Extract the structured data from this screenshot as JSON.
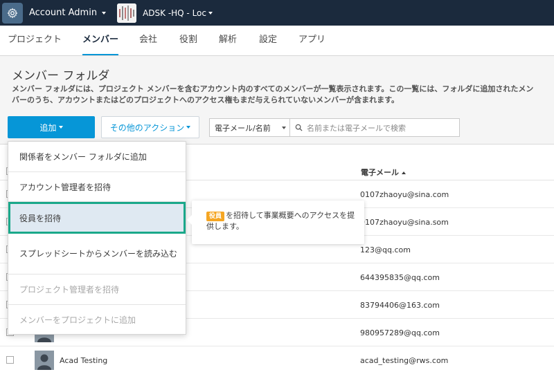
{
  "header": {
    "account_label": "Account Admin",
    "hub_label": "ADSK -HQ - Loc"
  },
  "nav": {
    "tabs": [
      {
        "label": "プロジェクト"
      },
      {
        "label": "メンバー"
      },
      {
        "label": "会社"
      },
      {
        "label": "役割"
      },
      {
        "label": "解析"
      },
      {
        "label": "設定"
      },
      {
        "label": "アプリ"
      }
    ],
    "active_tab": "メンバー"
  },
  "main": {
    "title": "メンバー フォルダ",
    "description": "メンバー フォルダには、プロジェクト メンバーを含むアカウント内のすべてのメンバーが一覧表示されます。この一覧には、フォルダに追加されたメンバーのうち、アカウントまたはどのプロジェクトへのアクセス権もまだ与えられていないメンバーが含まれます。"
  },
  "toolbar": {
    "add_label": "追加",
    "more_actions_label": "その他のアクション",
    "filter_value": "電子メール/名前",
    "search_placeholder": "名前または電子メールで検索"
  },
  "table": {
    "email_header": "電子メール",
    "rows": [
      {
        "name": "",
        "email": "0107zhaoyu@sina.com"
      },
      {
        "name": "",
        "email": "0107zhaoyu@sina.som"
      },
      {
        "name": "",
        "email": "123@qq.com"
      },
      {
        "name": "",
        "email": "644395835@qq.com"
      },
      {
        "name": "",
        "email": "83794406@163.com"
      },
      {
        "name": "",
        "email": "980957289@qq.com"
      },
      {
        "name": "Acad Testing",
        "email": "acad_testing@rws.com"
      }
    ]
  },
  "add_menu": {
    "items": [
      {
        "label": "関係者をメンバー フォルダに追加",
        "enabled": true
      },
      {
        "label": "アカウント管理者を招待",
        "enabled": true
      },
      {
        "label": "役員を招待",
        "enabled": true,
        "highlighted": true
      },
      {
        "label": "スプレッドシートからメンバーを読み込む",
        "enabled": true
      },
      {
        "label": "プロジェクト管理者を招待",
        "enabled": false
      },
      {
        "label": "メンバーをプロジェクトに追加",
        "enabled": false
      }
    ]
  },
  "tooltip": {
    "badge": "役員",
    "text": "を招待して事業概要へのアクセスを提供します。"
  },
  "colors": {
    "topbar": "#1b2a3d",
    "accent": "#0696d7",
    "highlight_border": "#1aa88a",
    "badge": "#f5a623"
  },
  "icons": {
    "settings": "gear-icon",
    "search": "search-icon",
    "avatar": "user-avatar-icon"
  }
}
